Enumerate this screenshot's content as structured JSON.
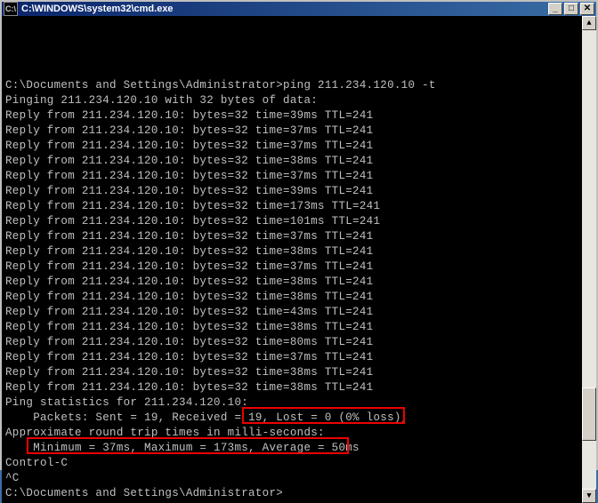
{
  "window": {
    "title": "C:\\WINDOWS\\system32\\cmd.exe",
    "icon_label": "cmd-icon"
  },
  "prompt": {
    "path": "C:\\Documents and Settings\\Administrator>",
    "command": "ping 211.234.120.10 -t"
  },
  "ping_header": "Pinging 211.234.120.10 with 32 bytes of data:",
  "host": "211.234.120.10",
  "replies": [
    {
      "bytes": 32,
      "time": "39ms",
      "ttl": 241
    },
    {
      "bytes": 32,
      "time": "37ms",
      "ttl": 241
    },
    {
      "bytes": 32,
      "time": "37ms",
      "ttl": 241
    },
    {
      "bytes": 32,
      "time": "38ms",
      "ttl": 241
    },
    {
      "bytes": 32,
      "time": "37ms",
      "ttl": 241
    },
    {
      "bytes": 32,
      "time": "39ms",
      "ttl": 241
    },
    {
      "bytes": 32,
      "time": "173ms",
      "ttl": 241
    },
    {
      "bytes": 32,
      "time": "101ms",
      "ttl": 241
    },
    {
      "bytes": 32,
      "time": "37ms",
      "ttl": 241
    },
    {
      "bytes": 32,
      "time": "38ms",
      "ttl": 241
    },
    {
      "bytes": 32,
      "time": "37ms",
      "ttl": 241
    },
    {
      "bytes": 32,
      "time": "38ms",
      "ttl": 241
    },
    {
      "bytes": 32,
      "time": "38ms",
      "ttl": 241
    },
    {
      "bytes": 32,
      "time": "43ms",
      "ttl": 241
    },
    {
      "bytes": 32,
      "time": "38ms",
      "ttl": 241
    },
    {
      "bytes": 32,
      "time": "80ms",
      "ttl": 241
    },
    {
      "bytes": 32,
      "time": "37ms",
      "ttl": 241
    },
    {
      "bytes": 32,
      "time": "38ms",
      "ttl": 241
    },
    {
      "bytes": 32,
      "time": "38ms",
      "ttl": 241
    }
  ],
  "stats": {
    "header": "Ping statistics for 211.234.120.10:",
    "packets_line": "    Packets: Sent = 19, Received = 19, Lost = 0 (0% loss),",
    "approx_line": "Approximate round trip times in milli-seconds:",
    "timing_line": "    Minimum = 37ms, Maximum = 173ms, Average = 50ms",
    "sent": 19,
    "received": 19,
    "lost": 0,
    "loss_pct": "0%",
    "minimum": "37ms",
    "maximum": "173ms",
    "average": "50ms"
  },
  "control_c": "Control-C",
  "caret_c": "^C",
  "prompt2": "C:\\Documents and Settings\\Administrator>",
  "title_buttons": {
    "min": "_",
    "max": "□",
    "close": "✕"
  },
  "scroll": {
    "up": "▲",
    "down": "▼"
  }
}
